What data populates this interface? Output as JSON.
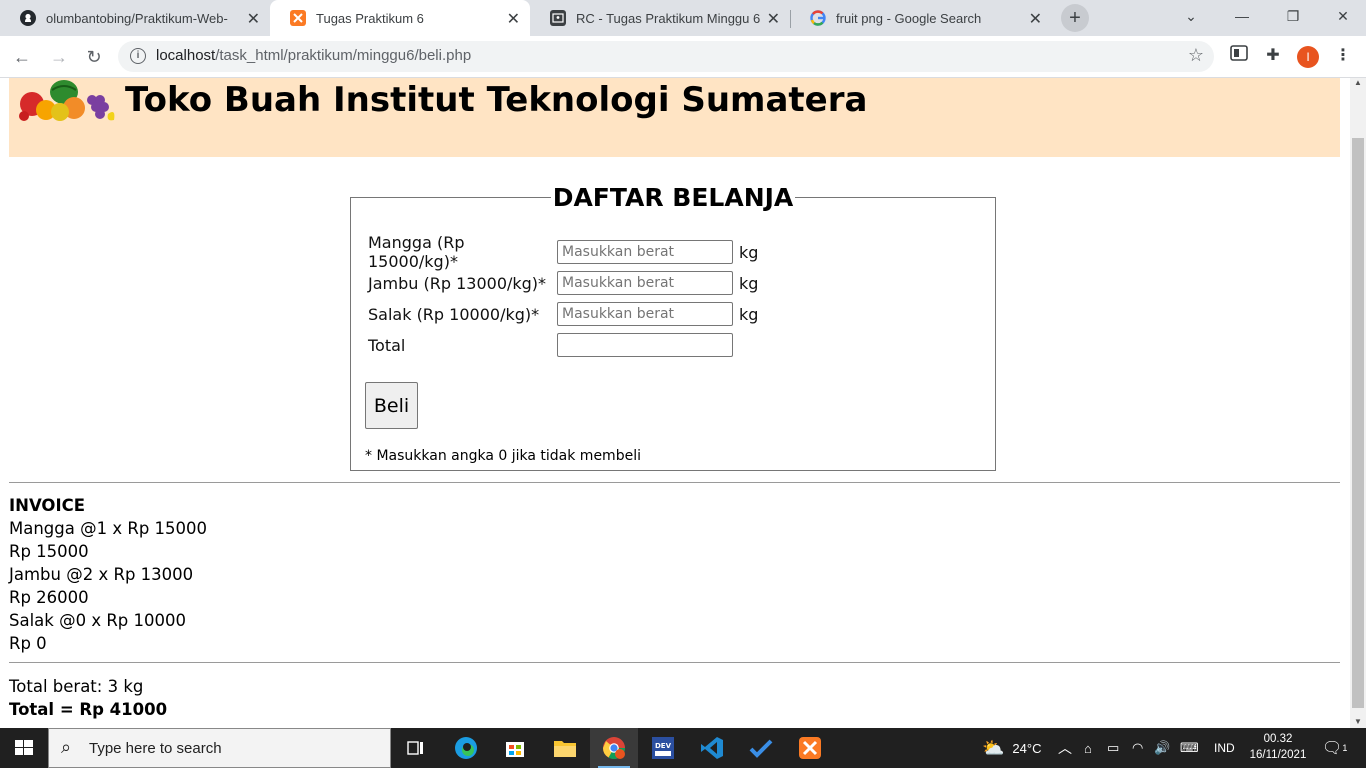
{
  "browser": {
    "tabs": [
      {
        "title": "olumbantobing/Praktikum-Web-",
        "icon": "github-icon",
        "active": false
      },
      {
        "title": "Tugas Praktikum 6",
        "icon": "xampp-icon",
        "active": true
      },
      {
        "title": "RC - Tugas Praktikum Minggu 6",
        "icon": "classroom-icon",
        "active": false
      },
      {
        "title": "fruit png - Google Search",
        "icon": "google-icon",
        "active": false
      }
    ],
    "url_host": "localhost",
    "url_path": "/task_html/praktikum/minggu6/beli.php",
    "profile_initial": "I"
  },
  "page": {
    "site_title": "Toko Buah Institut Teknologi Sumatera",
    "form": {
      "legend": "DAFTAR BELANJA",
      "fields": [
        {
          "label": "Mangga (Rp 15000/kg)*",
          "placeholder": "Masukkan berat",
          "unit": "kg"
        },
        {
          "label": "Jambu (Rp 13000/kg)*",
          "placeholder": "Masukkan berat",
          "unit": "kg"
        },
        {
          "label": "Salak (Rp 10000/kg)*",
          "placeholder": "Masukkan berat",
          "unit": "kg"
        }
      ],
      "total_label": "Total",
      "total_value": "",
      "submit_label": "Beli",
      "note": "* Masukkan angka 0 jika tidak membeli"
    },
    "invoice": {
      "heading": "INVOICE",
      "lines": [
        "Mangga @1 x Rp 15000",
        "Rp 15000",
        "Jambu @2 x Rp 13000",
        "Rp 26000",
        "Salak @0 x Rp 10000",
        "Rp 0"
      ],
      "total_weight": "Total berat: 3 kg",
      "total_price": "Total = Rp 41000"
    }
  },
  "taskbar": {
    "search_placeholder": "Type here to search",
    "weather": "24°C",
    "language": "IND",
    "time": "00.32",
    "date": "16/11/2021",
    "notification_count": "1"
  },
  "colors": {
    "header_bg": "#ffe4c4",
    "tabstrip_bg": "#dee1e6",
    "taskbar_bg": "#202020"
  }
}
